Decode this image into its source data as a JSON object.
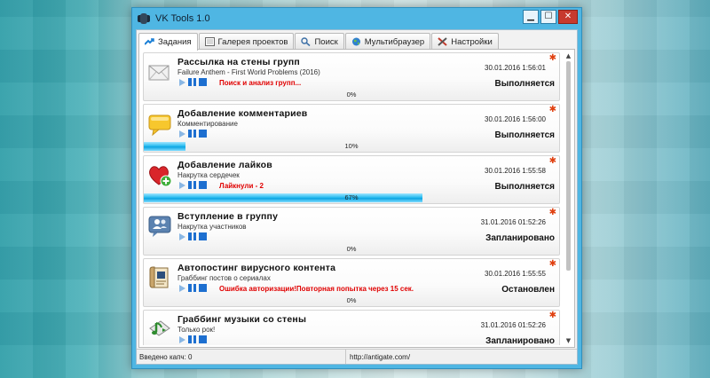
{
  "window": {
    "title": "VK Tools  1.0",
    "minimize": "▁",
    "maximize": "☐",
    "close": "✕"
  },
  "tabs": [
    {
      "label": "Задания",
      "icon": "tasks-icon",
      "active": true
    },
    {
      "label": "Галерея проектов",
      "icon": "gallery-icon",
      "active": false
    },
    {
      "label": "Поиск",
      "icon": "search-icon",
      "active": false
    },
    {
      "label": "Мультибраузер",
      "icon": "globe-icon",
      "active": false
    },
    {
      "label": "Настройки",
      "icon": "settings-icon",
      "active": false
    }
  ],
  "tasks": [
    {
      "name": "Рассылка на стены групп",
      "subtitle": "Failure Anthem - First World Problems (2016)",
      "message": "Поиск и анализ групп...",
      "date": "30.01.2016 1:56:01",
      "status": "Выполняется",
      "progress_label": "0%",
      "progress": 0,
      "icon": "envelope-icon"
    },
    {
      "name": "Добавление комментариев",
      "subtitle": "Комментирование",
      "message": "",
      "date": "30.01.2016 1:56:00",
      "status": "Выполняется",
      "progress_label": "10%",
      "progress": 10,
      "icon": "comment-icon"
    },
    {
      "name": "Добавление лайков",
      "subtitle": "Накрутка сердечек",
      "message": "Лайкнули - 2",
      "date": "30.01.2016 1:55:58",
      "status": "Выполняется",
      "progress_label": "67%",
      "progress": 67,
      "icon": "heart-add-icon"
    },
    {
      "name": "Вступление в группу",
      "subtitle": "Накрутка участников",
      "message": "",
      "date": "31.01.2016 01:52:26",
      "status": "Запланировано",
      "progress_label": "0%",
      "progress": 0,
      "icon": "group-icon"
    },
    {
      "name": "Автопостинг вирусного контента",
      "subtitle": "Граббинг постов о сериалах",
      "message": "Ошибка авторизации!Повторная попытка через 15 сек.",
      "date": "30.01.2016 1:55:55",
      "status": "Остановлен",
      "progress_label": "0%",
      "progress": 0,
      "icon": "document-icon"
    },
    {
      "name": "Граббинг музыки со стены",
      "subtitle": "Только рок!",
      "message": "",
      "date": "31.01.2016 01:52:26",
      "status": "Запланировано",
      "progress_label": "0%",
      "progress": 0,
      "icon": "music-icon"
    }
  ],
  "statusbar": {
    "captcha": "Введено капч: 0",
    "service": "http://antigate.com/"
  },
  "colors": {
    "window_frame": "#4fb6e3",
    "progress": "#0aa4e2",
    "error_text": "#e00000",
    "control_blue": "#1d6fd0"
  }
}
